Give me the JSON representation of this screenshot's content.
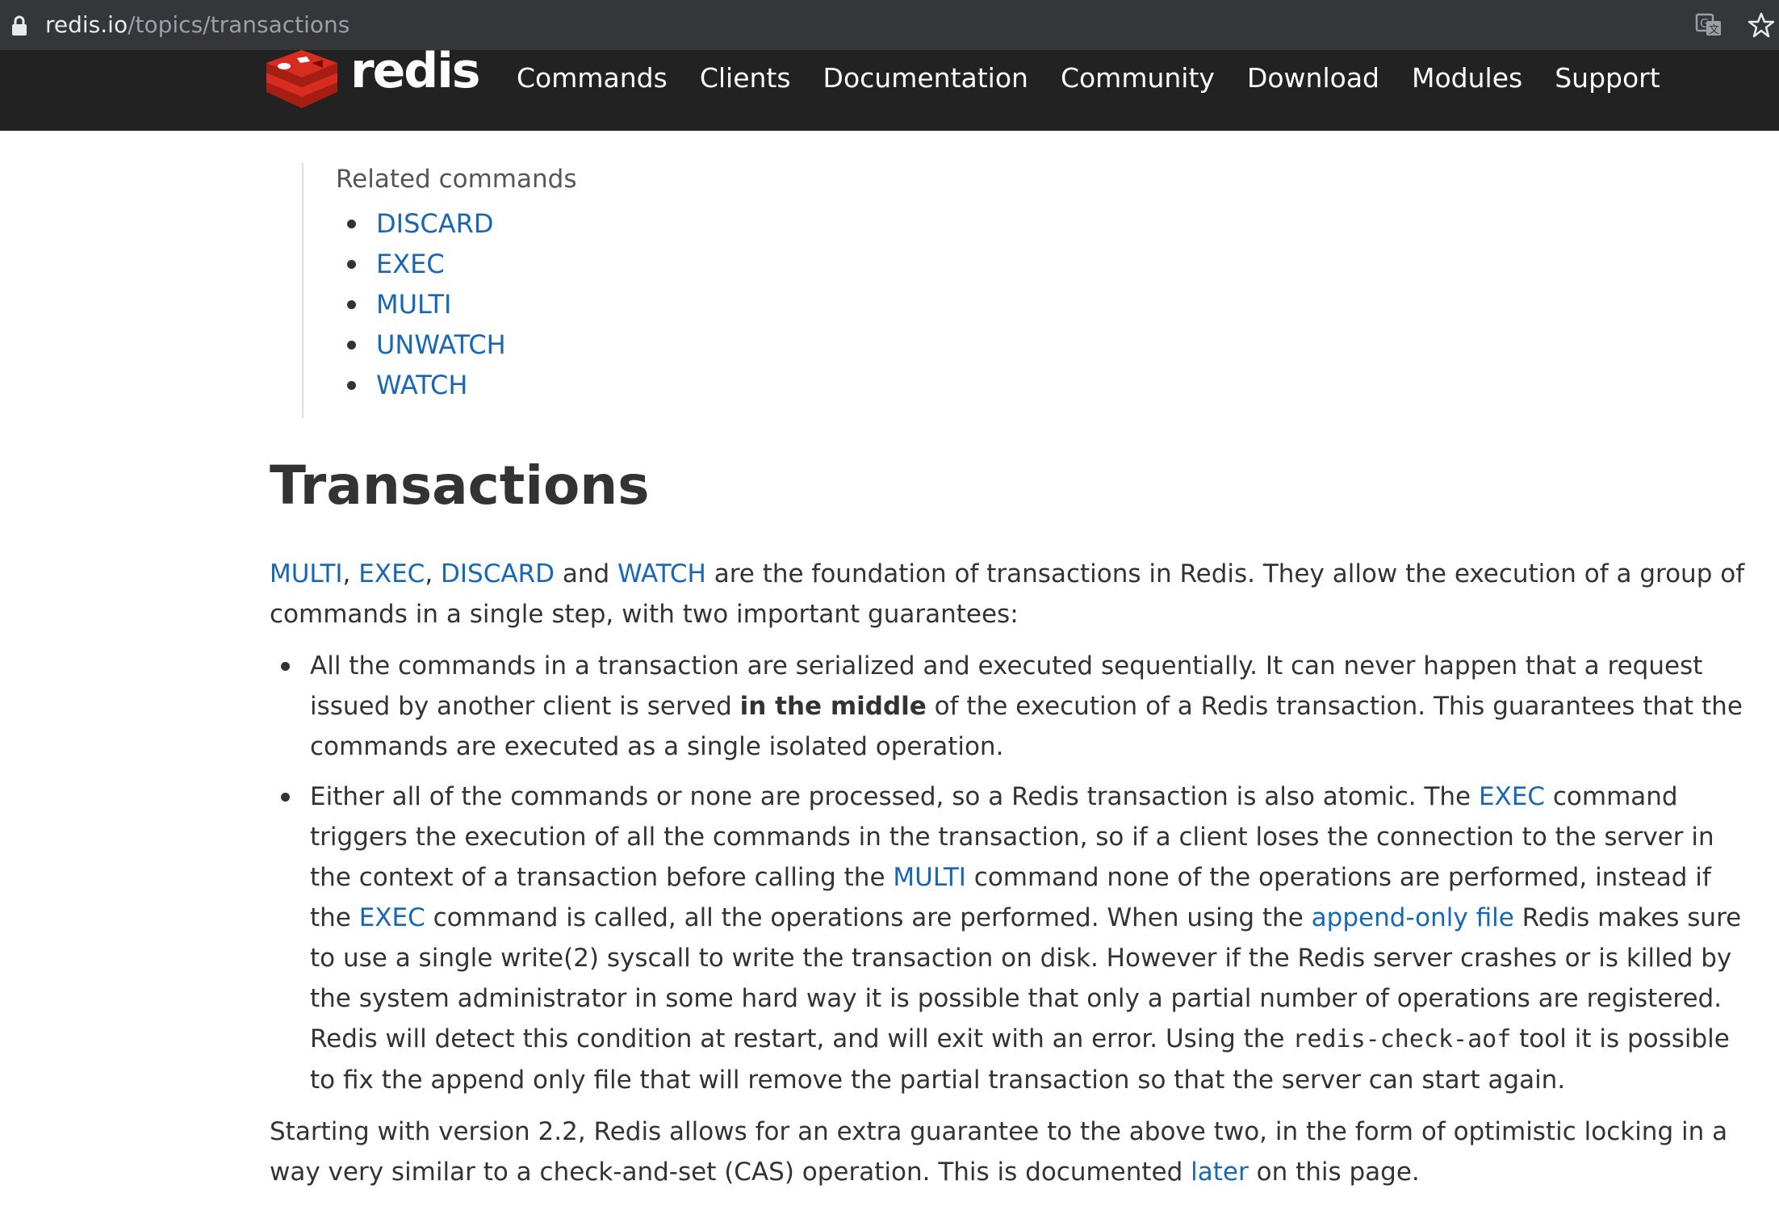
{
  "browser": {
    "url_host": "redis.io",
    "url_path": "/topics/transactions"
  },
  "header": {
    "logo_text": "redis",
    "nav": [
      "Commands",
      "Clients",
      "Documentation",
      "Community",
      "Download",
      "Modules",
      "Support"
    ]
  },
  "related": {
    "title": "Related commands",
    "items": [
      "DISCARD",
      "EXEC",
      "MULTI",
      "UNWATCH",
      "WATCH"
    ]
  },
  "page_title": "Transactions",
  "intro": {
    "link1": "MULTI",
    "sep1": ", ",
    "link2": "EXEC",
    "sep2": ", ",
    "link3": "DISCARD",
    "sep3": " and ",
    "link4": "WATCH",
    "line1_rest": " are the foundation of transactions in Redis. They allow the execution of a group of",
    "line2": "commands in a single step, with two important guarantees:"
  },
  "bullet1": {
    "line1": "All the commands in a transaction are serialized and executed sequentially. It can never happen that a request",
    "line2_a": "issued by another client is served ",
    "line2_bold": "in the middle",
    "line2_b": " of the execution of a Redis transaction. This guarantees that the",
    "line3": "commands are executed as a single isolated operation."
  },
  "bullet2": {
    "line1_a": "Either all of the commands or none are processed, so a Redis transaction is also atomic. The ",
    "line1_link": "EXEC",
    "line1_b": " command",
    "line2": "triggers the execution of all the commands in the transaction, so if a client loses the connection to the server in",
    "line3_a": "the context of a transaction before calling the ",
    "line3_link": "MULTI",
    "line3_b": " command none of the operations are performed, instead if",
    "line4_a": "the ",
    "line4_link1": "EXEC",
    "line4_b": " command is called, all the operations are performed. When using the ",
    "line4_link2": "append-only file",
    "line4_c": " Redis makes sure",
    "line5": "to use a single write(2) syscall to write the transaction on disk. However if the Redis server crashes or is killed by",
    "line6": "the system administrator in some hard way it is possible that only a partial number of operations are registered.",
    "line7_a": "Redis will detect this condition at restart, and will exit with an error. Using the ",
    "line7_code": "redis-check-aof",
    "line7_b": " tool it is possible",
    "line8": "to fix the append only file that will remove the partial transaction so that the server can start again."
  },
  "closing": {
    "line1": "Starting with version 2.2, Redis allows for an extra guarantee to the above two, in the form of optimistic locking in a",
    "line2_a": "way very similar to a check-and-set (CAS) operation. This is documented ",
    "line2_link": "later",
    "line2_b": " on this page."
  }
}
